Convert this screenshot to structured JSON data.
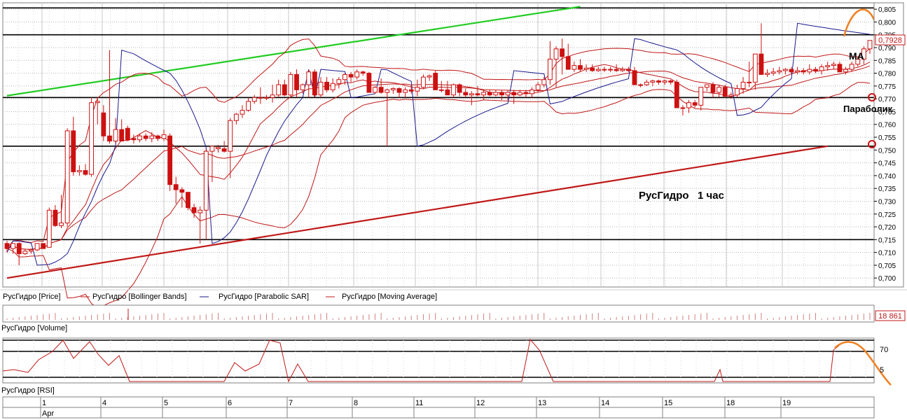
{
  "colors": {
    "candle_up": "#ffffff",
    "candle_down": "#cc1111",
    "candle_outline": "#cc1111",
    "bollinger": "#c01818",
    "parabolic_sar": "#1a1a8c",
    "moving_average": "#c01818",
    "trend_up_line": "#22cc22",
    "trend_support_line": "#c01818",
    "annotation_arrow": "#f08020",
    "level_line": "#000000",
    "grid": "#b8b8b8"
  },
  "annotations": {
    "title": "РусГидро   1 час",
    "ma": "MA",
    "parabolic": "Параболик",
    "price_tag": "0,7928",
    "volume_tag": "18 861"
  },
  "legend": {
    "price": "РусГидро [Price]",
    "bollinger": "РусГидро [Bollinger Bands]",
    "sar": "РусГидро [Parabolic SAR]",
    "ma": "РусГидро [Moving Average]"
  },
  "panels": {
    "volume_label": "РусГидро [Volume]",
    "rsi_label": "РусГидро [RSI]"
  },
  "chart_data": {
    "type": "candlestick",
    "title": "РусГидро   1 час",
    "y_axis": {
      "ylim": [
        0.6965,
        0.8075
      ],
      "ticks": [
        "0,805",
        "0,800",
        "0,795",
        "0,790",
        "0,785",
        "0,780",
        "0,775",
        "0,770",
        "0,765",
        "0,760",
        "0,755",
        "0,750",
        "0,745",
        "0,740",
        "0,735",
        "0,730",
        "0,725",
        "0,720",
        "0,715",
        "0,710",
        "0,705",
        "0,700"
      ]
    },
    "x_axis": {
      "day_labels": [
        "1",
        "4",
        "5",
        "6",
        "7",
        "8",
        "11",
        "12",
        "13",
        "14",
        "15",
        "18",
        "19"
      ],
      "month_label": "Apr",
      "candles_per_day": 10
    },
    "horizontal_levels": [
      0.8055,
      0.795,
      0.7705,
      0.7515,
      0.715
    ],
    "trendlines": [
      {
        "name": "uptrend",
        "x": [
          0,
          95
        ],
        "y": [
          0.7712,
          0.806
        ]
      },
      {
        "name": "support",
        "x": [
          0,
          136
        ],
        "y": [
          0.7,
          0.7515
        ]
      }
    ],
    "candles": [
      [
        0.7135,
        0.7145,
        0.71,
        0.7115
      ],
      [
        0.7115,
        0.7135,
        0.7095,
        0.7135
      ],
      [
        0.7135,
        0.714,
        0.705,
        0.7095
      ],
      [
        0.7095,
        0.7115,
        0.709,
        0.7105
      ],
      [
        0.7105,
        0.7115,
        0.7095,
        0.711
      ],
      [
        0.711,
        0.7135,
        0.7105,
        0.7135
      ],
      [
        0.7135,
        0.7135,
        0.712,
        0.7115
      ],
      [
        0.712,
        0.7275,
        0.712,
        0.7265
      ],
      [
        0.7265,
        0.7285,
        0.72,
        0.7205
      ],
      [
        0.7205,
        0.7325,
        0.7195,
        0.7215
      ],
      [
        0.7215,
        0.7585,
        0.72,
        0.7575
      ],
      [
        0.7575,
        0.763,
        0.74,
        0.7415
      ],
      [
        0.7415,
        0.744,
        0.74,
        0.742
      ],
      [
        0.742,
        0.7445,
        0.74,
        0.7405
      ],
      [
        0.7405,
        0.7705,
        0.7395,
        0.7685
      ],
      [
        0.7685,
        0.7705,
        0.76,
        0.769
      ],
      [
        0.7645,
        0.7675,
        0.7535,
        0.7555
      ],
      [
        0.7555,
        0.789,
        0.7525,
        0.7535
      ],
      [
        0.7535,
        0.7625,
        0.7525,
        0.758
      ],
      [
        0.758,
        0.762,
        0.7535,
        0.7535
      ],
      [
        0.7585,
        0.7595,
        0.7535,
        0.754
      ],
      [
        0.7545,
        0.756,
        0.7525,
        0.754
      ],
      [
        0.754,
        0.7565,
        0.753,
        0.7555
      ],
      [
        0.7555,
        0.7565,
        0.7535,
        0.7545
      ],
      [
        0.7545,
        0.757,
        0.753,
        0.7555
      ],
      [
        0.7555,
        0.756,
        0.7535,
        0.7545
      ],
      [
        0.7545,
        0.758,
        0.7535,
        0.756
      ],
      [
        0.7555,
        0.7565,
        0.734,
        0.7365
      ],
      [
        0.7365,
        0.7395,
        0.729,
        0.7345
      ],
      [
        0.7345,
        0.7355,
        0.7275,
        0.7335
      ],
      [
        0.7335,
        0.7335,
        0.7265,
        0.7275
      ],
      [
        0.7275,
        0.729,
        0.7235,
        0.7255
      ],
      [
        0.7255,
        0.728,
        0.7135,
        0.7265
      ],
      [
        0.7265,
        0.7505,
        0.715,
        0.7495
      ],
      [
        0.7495,
        0.751,
        0.7375,
        0.7515
      ],
      [
        0.7505,
        0.752,
        0.749,
        0.751
      ],
      [
        0.7505,
        0.7535,
        0.749,
        0.7495
      ],
      [
        0.7495,
        0.7625,
        0.739,
        0.7615
      ],
      [
        0.7615,
        0.7645,
        0.76,
        0.764
      ],
      [
        0.764,
        0.7675,
        0.7625,
        0.7655
      ],
      [
        0.7655,
        0.7705,
        0.765,
        0.769
      ],
      [
        0.769,
        0.7715,
        0.768,
        0.7705
      ],
      [
        0.7705,
        0.7745,
        0.768,
        0.7705
      ],
      [
        0.7705,
        0.7715,
        0.7695,
        0.7705
      ],
      [
        0.7705,
        0.7755,
        0.7685,
        0.7715
      ],
      [
        0.7715,
        0.7775,
        0.7705,
        0.7755
      ],
      [
        0.7755,
        0.7775,
        0.771,
        0.7715
      ],
      [
        0.7715,
        0.7805,
        0.771,
        0.7795
      ],
      [
        0.7795,
        0.7815,
        0.7705,
        0.7735
      ],
      [
        0.7735,
        0.776,
        0.772,
        0.7755
      ],
      [
        0.7755,
        0.7815,
        0.7705,
        0.7805
      ],
      [
        0.7805,
        0.7815,
        0.7705,
        0.7715
      ],
      [
        0.7715,
        0.7785,
        0.7705,
        0.7765
      ],
      [
        0.7765,
        0.7785,
        0.7725,
        0.7735
      ],
      [
        0.7735,
        0.778,
        0.7725,
        0.776
      ],
      [
        0.776,
        0.7785,
        0.774,
        0.7775
      ],
      [
        0.7775,
        0.78,
        0.7755,
        0.7795
      ],
      [
        0.7795,
        0.7805,
        0.7765,
        0.7785
      ],
      [
        0.7785,
        0.7815,
        0.7775,
        0.7805
      ],
      [
        0.7805,
        0.781,
        0.779,
        0.78
      ],
      [
        0.78,
        0.7805,
        0.7755,
        0.7725
      ],
      [
        0.7725,
        0.775,
        0.772,
        0.7745
      ],
      [
        0.7745,
        0.778,
        0.772,
        0.7725
      ],
      [
        0.7725,
        0.774,
        0.7515,
        0.7735
      ],
      [
        0.7735,
        0.7745,
        0.772,
        0.774
      ],
      [
        0.774,
        0.7745,
        0.7705,
        0.7725
      ],
      [
        0.7725,
        0.7745,
        0.7705,
        0.7735
      ],
      [
        0.7735,
        0.7755,
        0.772,
        0.773
      ],
      [
        0.773,
        0.7775,
        0.771,
        0.7745
      ],
      [
        0.7745,
        0.7795,
        0.774,
        0.7785
      ],
      [
        0.7785,
        0.7795,
        0.777,
        0.779
      ],
      [
        0.78,
        0.781,
        0.7735,
        0.7735
      ],
      [
        0.7735,
        0.777,
        0.7725,
        0.7735
      ],
      [
        0.7735,
        0.777,
        0.7715,
        0.7715
      ],
      [
        0.7715,
        0.776,
        0.7705,
        0.7755
      ],
      [
        0.7755,
        0.776,
        0.771,
        0.7725
      ],
      [
        0.7725,
        0.774,
        0.7705,
        0.7715
      ],
      [
        0.7715,
        0.773,
        0.7675,
        0.772
      ],
      [
        0.772,
        0.775,
        0.771,
        0.7715
      ],
      [
        0.7715,
        0.7735,
        0.7695,
        0.7725
      ],
      [
        0.7725,
        0.7735,
        0.771,
        0.7715
      ],
      [
        0.7715,
        0.7735,
        0.771,
        0.7725
      ],
      [
        0.7725,
        0.7735,
        0.7695,
        0.7715
      ],
      [
        0.7715,
        0.7735,
        0.7695,
        0.7725
      ],
      [
        0.7725,
        0.7735,
        0.768,
        0.7715
      ],
      [
        0.7715,
        0.7735,
        0.771,
        0.7725
      ],
      [
        0.7725,
        0.7735,
        0.7705,
        0.772
      ],
      [
        0.772,
        0.7745,
        0.7705,
        0.7735
      ],
      [
        0.7735,
        0.7765,
        0.7725,
        0.7755
      ],
      [
        0.7755,
        0.7785,
        0.7745,
        0.7775
      ],
      [
        0.7775,
        0.7925,
        0.7755,
        0.7855
      ],
      [
        0.7855,
        0.7905,
        0.7745,
        0.7895
      ],
      [
        0.7895,
        0.7935,
        0.7795,
        0.7865
      ],
      [
        0.7865,
        0.7915,
        0.7825,
        0.7815
      ],
      [
        0.7815,
        0.7845,
        0.7805,
        0.783
      ],
      [
        0.783,
        0.7855,
        0.7805,
        0.7815
      ],
      [
        0.7815,
        0.7835,
        0.7805,
        0.782
      ],
      [
        0.782,
        0.7835,
        0.7805,
        0.781
      ],
      [
        0.781,
        0.7825,
        0.7805,
        0.7815
      ],
      [
        0.7815,
        0.7825,
        0.7805,
        0.7815
      ],
      [
        0.7815,
        0.7825,
        0.7805,
        0.7815
      ],
      [
        0.7815,
        0.7835,
        0.7805,
        0.781
      ],
      [
        0.781,
        0.7825,
        0.7805,
        0.7815
      ],
      [
        0.7815,
        0.7825,
        0.7805,
        0.781
      ],
      [
        0.781,
        0.7825,
        0.7755,
        0.7755
      ],
      [
        0.7755,
        0.776,
        0.7745,
        0.7755
      ],
      [
        0.7755,
        0.7775,
        0.775,
        0.7765
      ],
      [
        0.7765,
        0.7775,
        0.775,
        0.777
      ],
      [
        0.777,
        0.7775,
        0.7755,
        0.7765
      ],
      [
        0.7765,
        0.7775,
        0.7755,
        0.777
      ],
      [
        0.777,
        0.7775,
        0.7755,
        0.7765
      ],
      [
        0.7765,
        0.7775,
        0.7665,
        0.7665
      ],
      [
        0.7665,
        0.7675,
        0.7635,
        0.7665
      ],
      [
        0.7665,
        0.7695,
        0.7645,
        0.7685
      ],
      [
        0.7685,
        0.7695,
        0.7665,
        0.7675
      ],
      [
        0.7675,
        0.7745,
        0.7655,
        0.7745
      ],
      [
        0.7745,
        0.7755,
        0.773,
        0.7755
      ],
      [
        0.7755,
        0.7765,
        0.7705,
        0.7725
      ],
      [
        0.7725,
        0.7755,
        0.7705,
        0.7745
      ],
      [
        0.7745,
        0.7755,
        0.7705,
        0.771
      ],
      [
        0.771,
        0.7725,
        0.77,
        0.7715
      ],
      [
        0.7715,
        0.7755,
        0.7705,
        0.774
      ],
      [
        0.774,
        0.7785,
        0.772,
        0.7765
      ],
      [
        0.7765,
        0.7845,
        0.7745,
        0.7765
      ],
      [
        0.7765,
        0.7795,
        0.7735,
        0.7875
      ],
      [
        0.7875,
        0.7995,
        0.7805,
        0.7795
      ],
      [
        0.7795,
        0.7815,
        0.7785,
        0.78
      ],
      [
        0.78,
        0.782,
        0.779,
        0.7805
      ],
      [
        0.7805,
        0.7825,
        0.7795,
        0.781
      ],
      [
        0.781,
        0.782,
        0.7795,
        0.7815
      ],
      [
        0.7815,
        0.7825,
        0.78,
        0.7805
      ],
      [
        0.7805,
        0.7825,
        0.7795,
        0.781
      ],
      [
        0.781,
        0.782,
        0.7795,
        0.7805
      ],
      [
        0.7805,
        0.7835,
        0.7795,
        0.7815
      ],
      [
        0.7815,
        0.7825,
        0.78,
        0.781
      ],
      [
        0.781,
        0.7835,
        0.7795,
        0.7825
      ],
      [
        0.7825,
        0.7845,
        0.781,
        0.783
      ],
      [
        0.783,
        0.7845,
        0.7815,
        0.7835
      ],
      [
        0.7835,
        0.7845,
        0.782,
        0.7805
      ],
      [
        0.7805,
        0.7825,
        0.7795,
        0.7815
      ],
      [
        0.7815,
        0.7845,
        0.7805,
        0.7835
      ],
      [
        0.7835,
        0.7865,
        0.7825,
        0.7855
      ],
      [
        0.7855,
        0.7905,
        0.7835,
        0.7895
      ],
      [
        0.7895,
        0.792,
        0.7875,
        0.7928
      ]
    ]
  }
}
